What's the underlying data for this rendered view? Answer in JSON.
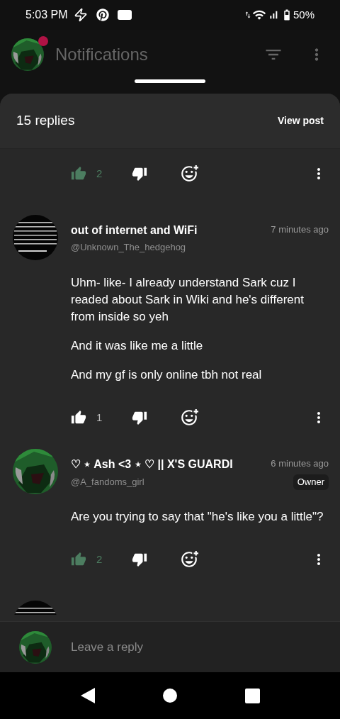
{
  "status_bar": {
    "time": "5:03 PM",
    "battery": "50%"
  },
  "header": {
    "title": "Notifications",
    "unread": true
  },
  "sheet": {
    "title": "15 replies",
    "action": "View post"
  },
  "replies": [
    {
      "kind": "actions_only",
      "likes": "2",
      "liked": true
    },
    {
      "kind": "comment",
      "name": "out of internet and WiFi",
      "handle": "@Unknown_The_hedgehog",
      "time": "7 minutes ago",
      "paragraphs": [
        "Uhm- like- I already understand Sark cuz I readed about Sark in Wiki and he's different from inside so yeh",
        "And it was like me a little",
        "And my gf is only online tbh not real"
      ],
      "likes": "1",
      "liked": false
    },
    {
      "kind": "comment",
      "name": "♡ ⋆ Ash <3 ⋆ ♡ || X'S GUARDI",
      "handle": "@A_fandoms_girl",
      "time": "6 minutes ago",
      "badge": "Owner",
      "paragraphs": [
        "Are you trying to say that \"he's like you a little\"?"
      ],
      "likes": "2",
      "liked": true
    },
    {
      "kind": "partial"
    }
  ],
  "reply_bar": {
    "placeholder": "Leave a reply"
  }
}
